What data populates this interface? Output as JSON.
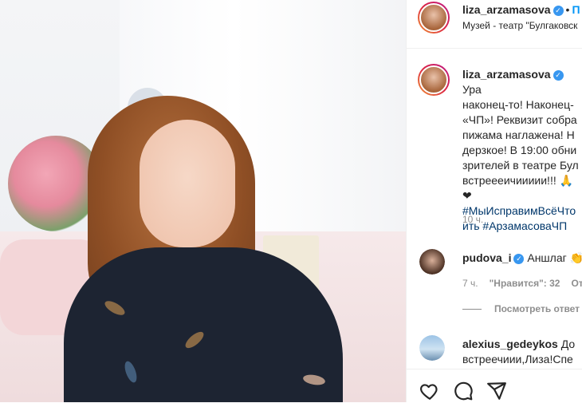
{
  "post": {
    "username": "liza_arzamasova",
    "verified": true,
    "separator": "•",
    "follow_label": "П",
    "location": "Музей - театр \"Булгаковск"
  },
  "caption": {
    "username": "liza_arzamasova",
    "text_1": " Ура",
    "lines": [
      "наконец-то! Наконец-",
      "«ЧП»! Реквизит собра",
      "пижама наглажена! Н",
      "дерзкое! В 19:00 обни",
      "зрителей в театре Бул",
      "встреееичиииии!!! 🙏❤"
    ],
    "hashtag_1": "#МыИсправимВсёЧто",
    "hashtag_2a": "ить",
    "hashtag_2b": "#АрзамасоваЧП",
    "time": "10 ч."
  },
  "comments": [
    {
      "username": "pudova_i",
      "verified": true,
      "text": "Аншлаг 👏",
      "time": "7 ч.",
      "likes": "\"Нравится\": 32",
      "reply": "От"
    },
    {
      "username": "alexius_gedeykos",
      "verified": false,
      "text": "До",
      "text_2": "встреечиии,Лиза!Спе"
    }
  ],
  "view_replies": "Посмотреть ответ",
  "icons": [
    "heart-icon",
    "comment-icon",
    "share-icon"
  ]
}
